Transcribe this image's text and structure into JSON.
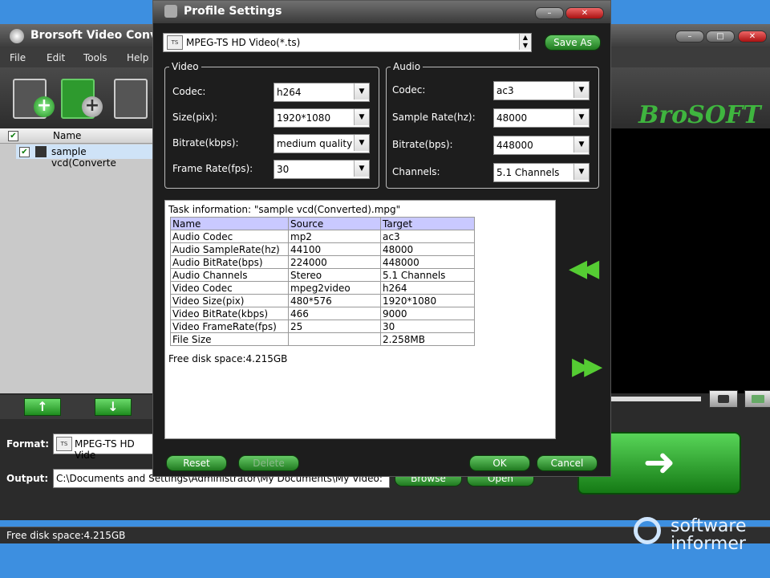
{
  "app": {
    "title": "Brorsoft Video Conv",
    "menu": [
      "File",
      "Edit",
      "Tools",
      "Help"
    ],
    "brand": "BroSOFT",
    "file_list": {
      "header": "Name",
      "row": "sample vcd(Converte"
    },
    "format_label": "Format:",
    "format_value": "MPEG-TS HD Vide",
    "output_label": "Output:",
    "output_value": "C:\\Documents and Settings\\Administrator\\My Documents\\My Video:",
    "browse_label": "Browse",
    "open_label": "Open",
    "status": "Free disk space:4.215GB"
  },
  "dialog": {
    "title": "Profile Settings",
    "profile": "MPEG-TS HD Video(*.ts)",
    "save_as": "Save As",
    "video": {
      "group": "Video",
      "codec_label": "Codec:",
      "codec": "h264",
      "size_label": "Size(pix):",
      "size": "1920*1080",
      "bitrate_label": "Bitrate(kbps):",
      "bitrate": "medium quality",
      "framerate_label": "Frame Rate(fps):",
      "framerate": "30"
    },
    "audio": {
      "group": "Audio",
      "codec_label": "Codec:",
      "codec": "ac3",
      "samplerate_label": "Sample Rate(hz):",
      "samplerate": "48000",
      "bitrate_label": "Bitrate(bps):",
      "bitrate": "448000",
      "channels_label": "Channels:",
      "channels": "5.1 Channels"
    },
    "task_info": "Task information: \"sample vcd(Converted).mpg\"",
    "table": {
      "headers": [
        "Name",
        "Source",
        "Target"
      ],
      "rows": [
        [
          "Audio Codec",
          "mp2",
          "ac3"
        ],
        [
          "Audio SampleRate(hz)",
          "44100",
          "48000"
        ],
        [
          "Audio BitRate(bps)",
          "224000",
          "448000"
        ],
        [
          "Audio Channels",
          "Stereo",
          "5.1 Channels"
        ],
        [
          "Video Codec",
          "mpeg2video",
          "h264"
        ],
        [
          "Video Size(pix)",
          "480*576",
          "1920*1080"
        ],
        [
          "Video BitRate(kbps)",
          "466",
          "9000"
        ],
        [
          "Video FrameRate(fps)",
          "25",
          "30"
        ],
        [
          "File Size",
          "",
          "2.258MB"
        ]
      ]
    },
    "free_disk": "Free disk space:4.215GB",
    "reset": "Reset",
    "delete": "Delete",
    "ok": "OK",
    "cancel": "Cancel"
  },
  "watermark": {
    "line1": "software",
    "line2": "informer"
  }
}
